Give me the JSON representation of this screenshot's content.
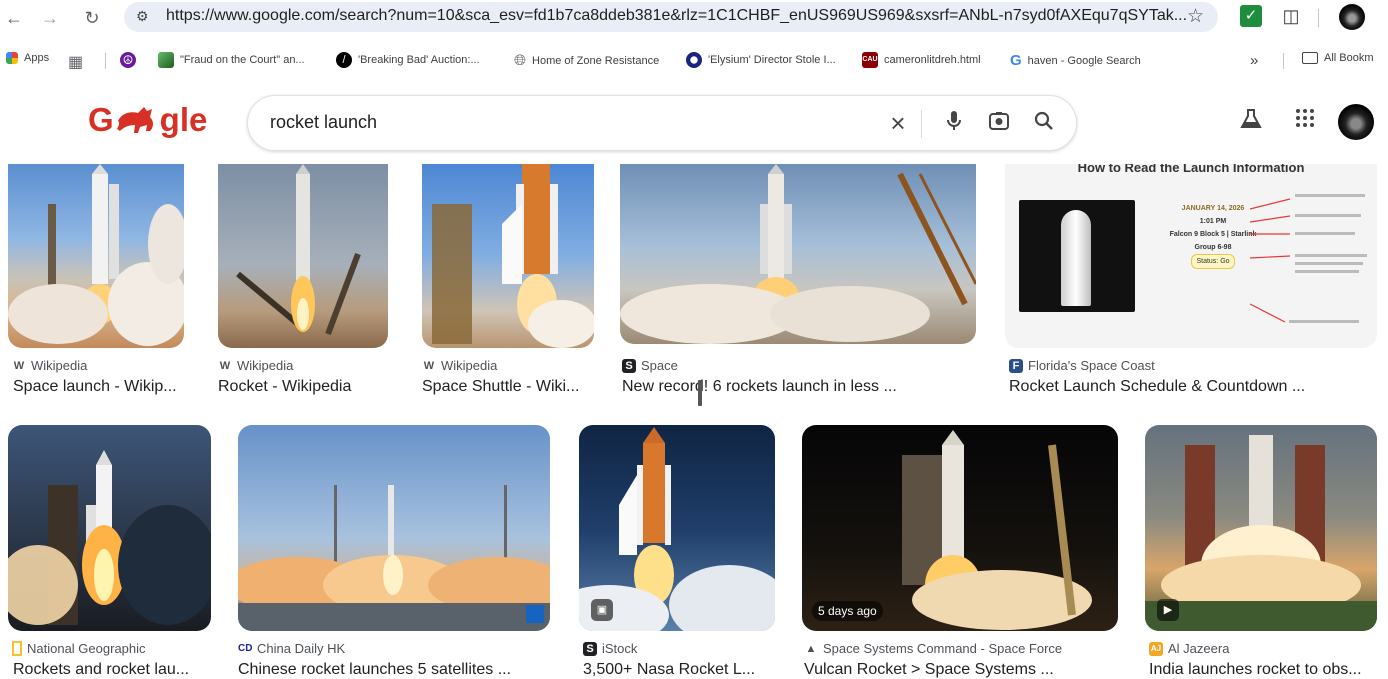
{
  "browser": {
    "url": "https://www.google.com/search?num=10&sca_esv=fd1b7ca8ddeb381e&rlz=1C1CHBF_enUS969US969&sxsrf=ANbL-n7syd0fAXEqu7qSYTak...",
    "bookmarks": [
      {
        "label": "Apps",
        "icon": "apps-grid-icon",
        "color": "#ea4335"
      },
      {
        "label": "",
        "icon": "grid-icon",
        "color": "#5f6368"
      },
      {
        "label": "",
        "icon": "peace-icon",
        "color": "#6a1b9a"
      },
      {
        "label": "\"Fraud on the Court\" an...",
        "icon": "page-icon",
        "color": "#2e7d32"
      },
      {
        "label": "'Breaking Bad' Auction:...",
        "icon": "slash-icon",
        "color": "#000000"
      },
      {
        "label": "Home of Zone Resistance",
        "icon": "globe-icon",
        "color": "#5f6368"
      },
      {
        "label": "'Elysium' Director Stole I...",
        "icon": "circle-icon",
        "color": "#1a237e"
      },
      {
        "label": "cameronlitdreh.html",
        "icon": "cau-icon",
        "color": "#8b0000"
      },
      {
        "label": "haven - Google Search",
        "icon": "google-icon",
        "color": "#4285f4"
      }
    ],
    "overflow_label": "»",
    "all_bookmarks_label": "All Bookm"
  },
  "search": {
    "query": "rocket launch"
  },
  "results_row1": [
    {
      "source": "Wikipedia",
      "source_icon": "W",
      "title": "Space launch - Wikip..."
    },
    {
      "source": "Wikipedia",
      "source_icon": "W",
      "title": "Rocket - Wikipedia"
    },
    {
      "source": "Wikipedia",
      "source_icon": "W",
      "title": "Space Shuttle - Wiki..."
    },
    {
      "source": "Space",
      "source_icon": "S",
      "title": "New record! 6 rockets launch in less ..."
    },
    {
      "source": "Florida's Space Coast",
      "source_icon": "F",
      "title": "Rocket Launch Schedule & Countdown ..."
    }
  ],
  "results_row2": [
    {
      "source": "National Geographic",
      "source_icon": "NG",
      "title": "Rockets and rocket lau..."
    },
    {
      "source": "China Daily HK",
      "source_icon": "CD",
      "title": "Chinese rocket launches 5 satellites ..."
    },
    {
      "source": "iStock",
      "source_icon": "S",
      "title": "3,500+ Nasa Rocket L..."
    },
    {
      "source": "Space Systems Command - Space Force",
      "source_icon": "A",
      "title": "Vulcan Rocket > Space Systems ..."
    },
    {
      "source": "Al Jazeera",
      "source_icon": "AJ",
      "title": "India launches rocket to obs..."
    }
  ],
  "badges": {
    "vulcan_age": "5 days ago"
  },
  "infographic": {
    "heading": "How to Read the Launch Information",
    "date": "JANUARY 14, 2026",
    "time": "1:01 PM",
    "vehicle": "Falcon 9 Block 5 | Starlink",
    "group": "Group 6-98",
    "status": "Status: Go"
  }
}
